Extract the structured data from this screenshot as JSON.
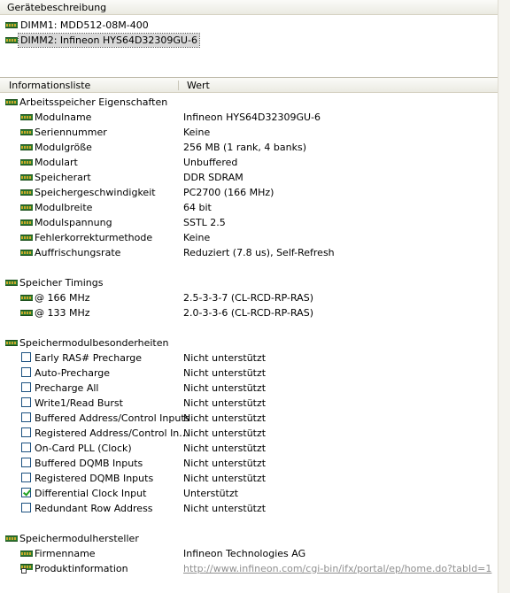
{
  "device_header": "Gerätebeschreibung",
  "devices": [
    {
      "label": "DIMM1: MDD512-08M-400",
      "selected": false
    },
    {
      "label": "DIMM2: Infineon HYS64D32309GU-6",
      "selected": true
    }
  ],
  "info_header": {
    "col1": "Informationsliste",
    "col2": "Wert"
  },
  "groups": [
    {
      "title": "Arbeitsspeicher Eigenschaften",
      "rows": [
        {
          "label": "Modulname",
          "value": "Infineon HYS64D32309GU-6"
        },
        {
          "label": "Seriennummer",
          "value": "Keine"
        },
        {
          "label": "Modulgröße",
          "value": "256 MB (1 rank, 4 banks)"
        },
        {
          "label": "Modulart",
          "value": "Unbuffered"
        },
        {
          "label": "Speicherart",
          "value": "DDR SDRAM"
        },
        {
          "label": "Speichergeschwindigkeit",
          "value": "PC2700 (166 MHz)"
        },
        {
          "label": "Modulbreite",
          "value": "64 bit"
        },
        {
          "label": "Modulspannung",
          "value": "SSTL 2.5"
        },
        {
          "label": "Fehlerkorrekturmethode",
          "value": "Keine"
        },
        {
          "label": "Auffrischungsrate",
          "value": "Reduziert (7.8 us), Self-Refresh"
        }
      ]
    },
    {
      "title": "Speicher Timings",
      "rows": [
        {
          "label": "@ 166 MHz",
          "value": "2.5-3-3-7  (CL-RCD-RP-RAS)"
        },
        {
          "label": "@ 133 MHz",
          "value": "2.0-3-3-6  (CL-RCD-RP-RAS)"
        }
      ]
    },
    {
      "title": "Speichermodulbesonderheiten",
      "checks": [
        {
          "label": "Early RAS# Precharge",
          "value": "Nicht unterstützt",
          "checked": false
        },
        {
          "label": "Auto-Precharge",
          "value": "Nicht unterstützt",
          "checked": false
        },
        {
          "label": "Precharge All",
          "value": "Nicht unterstützt",
          "checked": false
        },
        {
          "label": "Write1/Read Burst",
          "value": "Nicht unterstützt",
          "checked": false
        },
        {
          "label": "Buffered Address/Control Inputs",
          "value": "Nicht unterstützt",
          "checked": false
        },
        {
          "label": "Registered Address/Control In...",
          "value": "Nicht unterstützt",
          "checked": false
        },
        {
          "label": "On-Card PLL (Clock)",
          "value": "Nicht unterstützt",
          "checked": false
        },
        {
          "label": "Buffered DQMB Inputs",
          "value": "Nicht unterstützt",
          "checked": false
        },
        {
          "label": "Registered DQMB Inputs",
          "value": "Nicht unterstützt",
          "checked": false
        },
        {
          "label": "Differential Clock Input",
          "value": "Unterstützt",
          "checked": true
        },
        {
          "label": "Redundant Row Address",
          "value": "Nicht unterstützt",
          "checked": false
        }
      ]
    },
    {
      "title": "Speichermodulhersteller",
      "rows": [
        {
          "label": "Firmenname",
          "value": "Infineon Technologies AG"
        },
        {
          "label": "Produktinformation",
          "value": "http://www.infineon.com/cgi-bin/ifx/portal/ep/home.do?tabId=1",
          "link": true
        }
      ]
    }
  ]
}
